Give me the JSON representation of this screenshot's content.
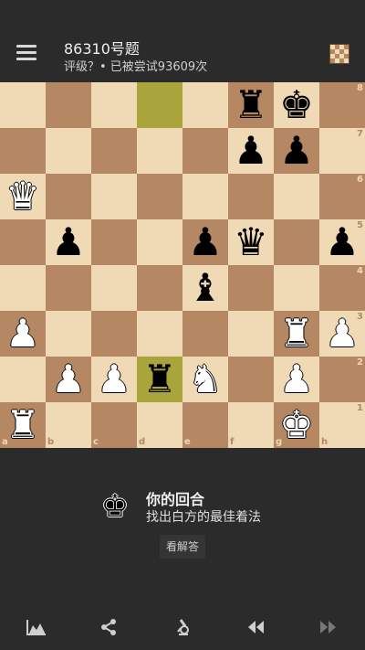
{
  "header": {
    "title": "86310号题",
    "subtitle": "评级？• 已被尝试93609次"
  },
  "board": {
    "ranks": [
      "8",
      "7",
      "6",
      "5",
      "4",
      "3",
      "2",
      "1"
    ],
    "files": [
      "a",
      "b",
      "c",
      "d",
      "e",
      "f",
      "g",
      "h"
    ],
    "highlighted_squares": [
      "d8",
      "d2"
    ],
    "pieces": [
      {
        "square": "f8",
        "color": "black",
        "type": "rook",
        "glyph": "♜"
      },
      {
        "square": "g8",
        "color": "black",
        "type": "king",
        "glyph": "♚"
      },
      {
        "square": "f7",
        "color": "black",
        "type": "pawn",
        "glyph": "♟"
      },
      {
        "square": "g7",
        "color": "black",
        "type": "pawn",
        "glyph": "♟"
      },
      {
        "square": "a6",
        "color": "white",
        "type": "queen",
        "glyph": "♛"
      },
      {
        "square": "b5",
        "color": "black",
        "type": "pawn",
        "glyph": "♟"
      },
      {
        "square": "e5",
        "color": "black",
        "type": "pawn",
        "glyph": "♟"
      },
      {
        "square": "f5",
        "color": "black",
        "type": "queen",
        "glyph": "♛"
      },
      {
        "square": "h5",
        "color": "black",
        "type": "pawn",
        "glyph": "♟"
      },
      {
        "square": "e4",
        "color": "black",
        "type": "bishop",
        "glyph": "♝"
      },
      {
        "square": "a3",
        "color": "white",
        "type": "pawn",
        "glyph": "♟"
      },
      {
        "square": "g3",
        "color": "white",
        "type": "rook",
        "glyph": "♜"
      },
      {
        "square": "h3",
        "color": "white",
        "type": "pawn",
        "glyph": "♟"
      },
      {
        "square": "b2",
        "color": "white",
        "type": "pawn",
        "glyph": "♟"
      },
      {
        "square": "c2",
        "color": "white",
        "type": "pawn",
        "glyph": "♟"
      },
      {
        "square": "d2",
        "color": "black",
        "type": "rook",
        "glyph": "♜"
      },
      {
        "square": "e2",
        "color": "white",
        "type": "knight",
        "glyph": "♞"
      },
      {
        "square": "g2",
        "color": "white",
        "type": "pawn",
        "glyph": "♟"
      },
      {
        "square": "a1",
        "color": "white",
        "type": "rook",
        "glyph": "♜"
      },
      {
        "square": "g1",
        "color": "white",
        "type": "king",
        "glyph": "♚"
      }
    ]
  },
  "status": {
    "turn_title": "你的回合",
    "turn_subtitle": "找出白方的最佳着法",
    "solution_button": "看解答",
    "king_glyph": "♚"
  },
  "toolbar": {
    "items": [
      "chart-icon",
      "share-icon",
      "analysis-icon",
      "rewind-icon",
      "forward-icon"
    ]
  },
  "colors": {
    "background": "#2b2b2b",
    "light_square": "#f0d9b5",
    "dark_square": "#b58863",
    "highlight": "#a9a43c"
  }
}
